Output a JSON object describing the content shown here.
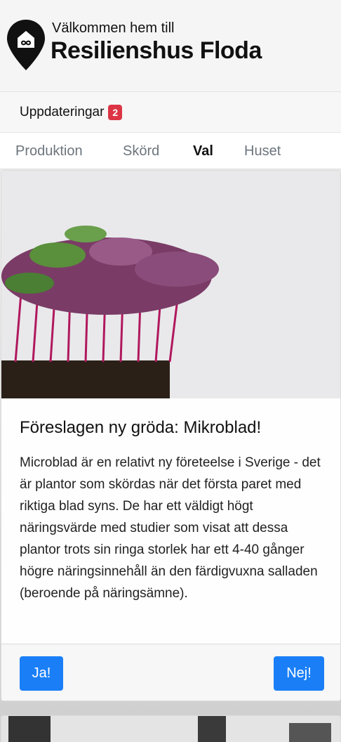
{
  "header": {
    "welcome": "Välkommen hem till",
    "brand": "Resilienshus Floda",
    "logo_icon": "house-infinity-pin-icon"
  },
  "updates": {
    "label": "Uppdateringar",
    "count": "2"
  },
  "tabs": [
    {
      "label": "Produktion",
      "active": false
    },
    {
      "label": "Skörd",
      "active": false
    },
    {
      "label": "Val",
      "active": true
    },
    {
      "label": "Huset",
      "active": false
    }
  ],
  "card": {
    "image_subject": "microgreens-photo",
    "title": "Föreslagen ny gröda: Mikroblad!",
    "text": "Microblad är en relativt ny företeelse i Sverige - det är plantor som skördas när det första paret med riktiga blad syns. De har ett väldigt högt näringsvärde med studier som visat att dessa plantor trots sin ringa storlek har ett 4-40 gånger högre näringsinnehåll än den färdigvuxna salladen (beroende på näringsämne).",
    "yes_label": "Ja!",
    "no_label": "Nej!"
  },
  "colors": {
    "primary": "#1a7ff7",
    "badge": "#dc3545",
    "brand_text": "#111111"
  }
}
